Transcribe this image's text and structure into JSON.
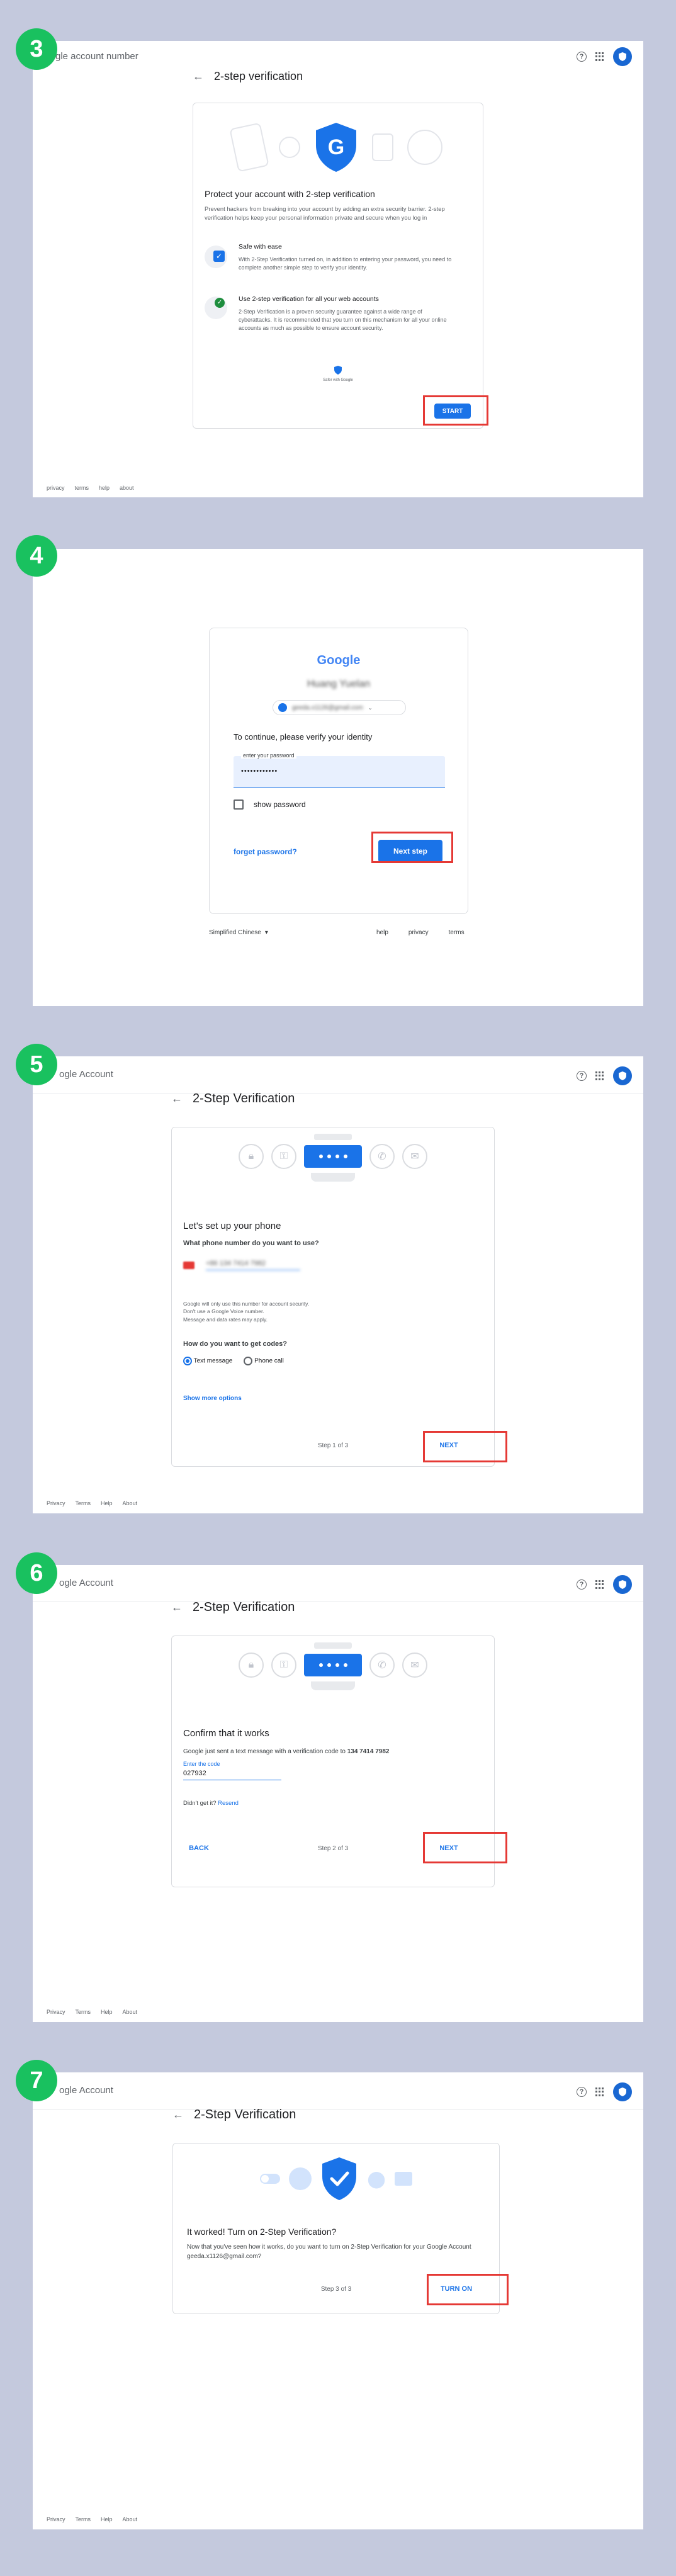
{
  "colors": {
    "badge": "#19c15f",
    "accent": "#1a73e8",
    "highlight": "#e53935"
  },
  "s3": {
    "badge": "3",
    "brand": "gle account number",
    "title": "2-step verification",
    "heading": "Protect your account with 2-step verification",
    "intro": "Prevent hackers from breaking into your account by adding an extra security barrier. 2-step verification helps keep your personal information private and secure when you log in",
    "f1_title": "Safe with ease",
    "f1_text": "With 2-Step Verification turned on, in addition to entering your password, you need to complete another simple step to verify your identity.",
    "f2_title": "Use 2-step verification for all your web accounts",
    "f2_text": "2-Step Verification is a proven security guarantee against a wide range of cyberattacks. It is recommended that you turn on this mechanism for all your online accounts as much as possible to ensure account security.",
    "safer": "Safer with Google",
    "start": "START",
    "footer": [
      "privacy",
      "terms",
      "help",
      "about"
    ]
  },
  "s4": {
    "badge": "4",
    "logo": "Google",
    "name": "Huang Yuelan",
    "email": "geeda.x1126@gmail.com",
    "prompt": "To continue, please verify your identity",
    "pw_label": "enter your password",
    "pw_value": "••••••••••••",
    "show_pw": "show password",
    "forgot": "forget password?",
    "next": "Next step",
    "lang": "Simplified Chinese",
    "links": [
      "help",
      "privacy",
      "terms"
    ]
  },
  "s5": {
    "badge": "5",
    "brand": "ogle Account",
    "title": "2-Step Verification",
    "heading": "Let's set up your phone",
    "q1": "What phone number do you want to use?",
    "phone": "+86 134 7414 7982",
    "notes": [
      "Google will only use this number for account security.",
      "Don't use a Google Voice number.",
      "Message and data rates may apply."
    ],
    "q2": "How do you want to get codes?",
    "opt1": "Text message",
    "opt2": "Phone call",
    "more": "Show more options",
    "step": "Step 1 of 3",
    "next": "NEXT",
    "footer": [
      "Privacy",
      "Terms",
      "Help",
      "About"
    ]
  },
  "s6": {
    "badge": "6",
    "brand": "ogle Account",
    "title": "2-Step Verification",
    "heading": "Confirm that it works",
    "sent_pre": "Google just sent a text message with a verification code to",
    "sent_num": "134 7414 7982",
    "enter": "Enter the code",
    "code": "027932",
    "resend_pre": "Didn't get it?",
    "resend": "Resend",
    "back": "BACK",
    "step": "Step 2 of 3",
    "next": "NEXT",
    "footer": [
      "Privacy",
      "Terms",
      "Help",
      "About"
    ]
  },
  "s7": {
    "badge": "7",
    "brand": "ogle Account",
    "title": "2-Step Verification",
    "heading": "It worked! Turn on 2-Step Verification?",
    "text": "Now that you've seen how it works, do you want to turn on 2-Step Verification for your Google Account geeda.x1126@gmail.com?",
    "step": "Step 3 of 3",
    "turnon": "TURN ON",
    "footer": [
      "Privacy",
      "Terms",
      "Help",
      "About"
    ]
  }
}
